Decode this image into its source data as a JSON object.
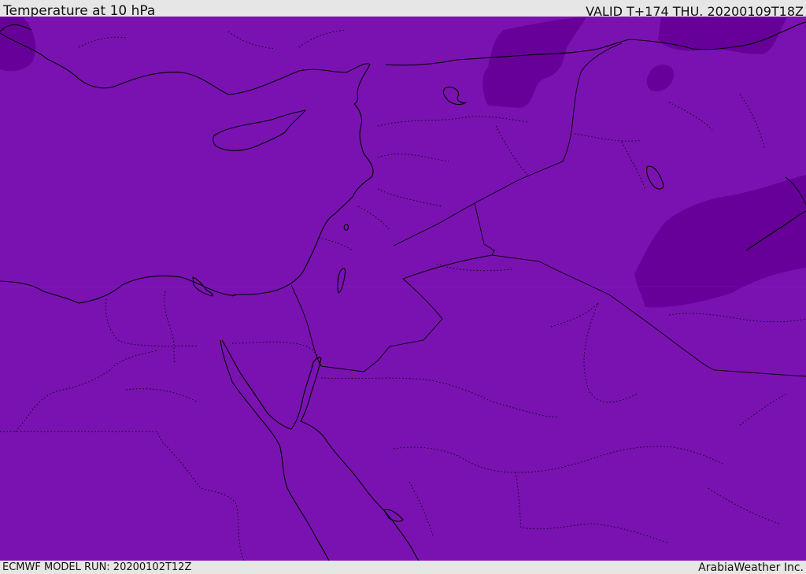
{
  "header": {
    "title": "Temperature at 10 hPa",
    "valid": "VALID T+174 THU. 20200109T18Z"
  },
  "footer": {
    "model_run": "ECMWF MODEL RUN: 20200102T12Z",
    "credit": "ArabiaWeather Inc."
  },
  "map": {
    "base_color": "#7a12b2",
    "cold_color": "#660099",
    "coast_color": "#000000",
    "border_style": "dotted"
  }
}
